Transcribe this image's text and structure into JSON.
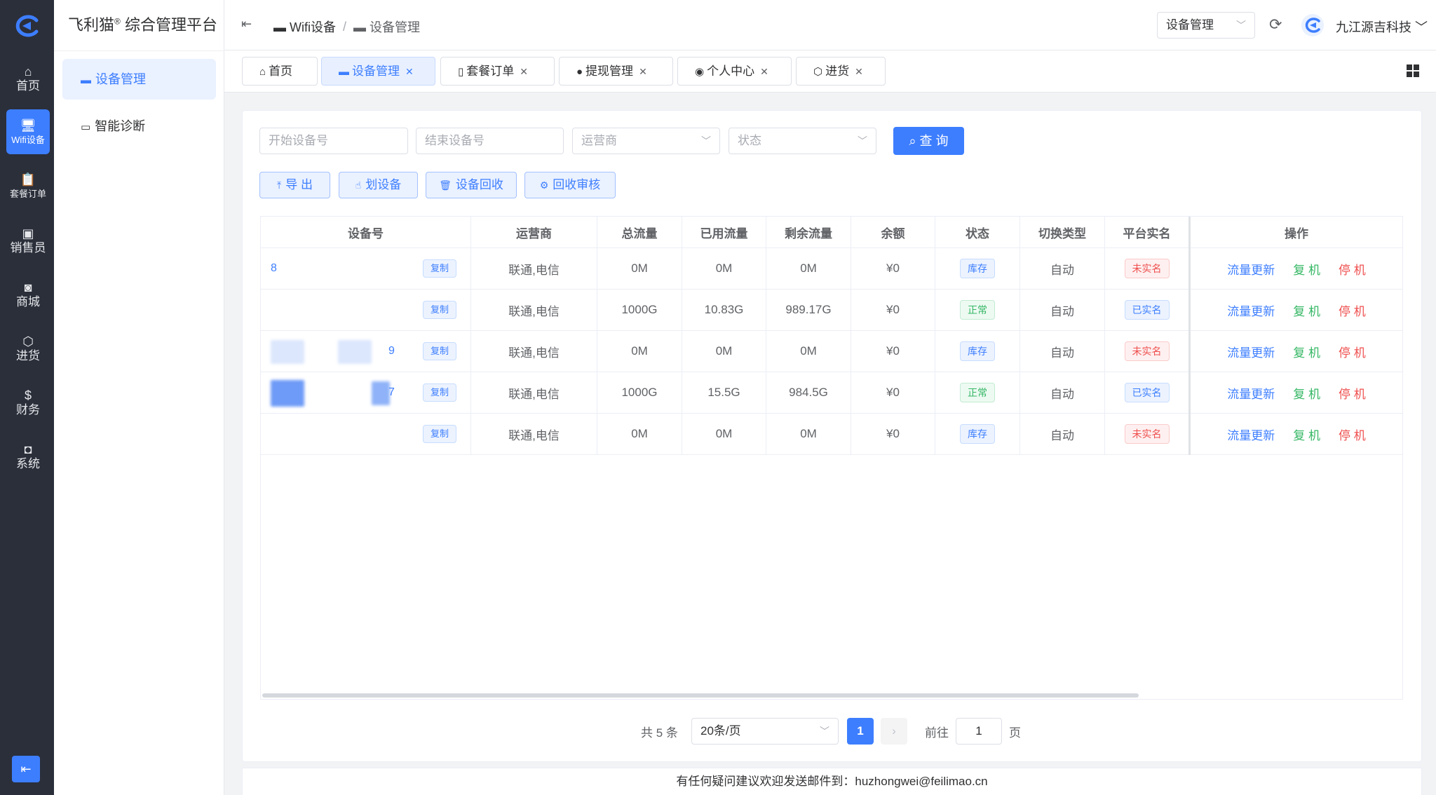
{
  "app": {
    "title_main": "飞利猫",
    "title_sup": "®",
    "title_rest": " 综合管理平台"
  },
  "rail": {
    "items": [
      {
        "label": "首页",
        "icon": "home-icon"
      },
      {
        "label": "Wifi设备",
        "icon": "monitor-icon"
      },
      {
        "label": "套餐订单",
        "icon": "clipboard-icon"
      },
      {
        "label": "销售员",
        "icon": "id-card-icon"
      },
      {
        "label": "商城",
        "icon": "shop-icon"
      },
      {
        "label": "进货",
        "icon": "box-icon"
      },
      {
        "label": "财务",
        "icon": "coin-icon"
      },
      {
        "label": "系统",
        "icon": "user-box-icon"
      }
    ],
    "active_index": 1
  },
  "sidebar": {
    "items": [
      {
        "label": "设备管理"
      },
      {
        "label": "智能诊断"
      }
    ]
  },
  "header": {
    "breadcrumb": [
      "Wifi设备",
      "设备管理"
    ],
    "select_value": "设备管理",
    "user_name": "九江源吉科技"
  },
  "tabs": [
    {
      "label": "首页",
      "closable": false
    },
    {
      "label": "设备管理",
      "closable": true,
      "active": true
    },
    {
      "label": "套餐订单",
      "closable": true
    },
    {
      "label": "提现管理",
      "closable": true
    },
    {
      "label": "个人中心",
      "closable": true
    },
    {
      "label": "进货",
      "closable": true
    }
  ],
  "filters": {
    "start_placeholder": "开始设备号",
    "end_placeholder": "结束设备号",
    "operator_placeholder": "运营商",
    "status_placeholder": "状态",
    "query_label": "查 询"
  },
  "toolbar": {
    "export_label": "导 出",
    "assign_label": "划设备",
    "recycle_label": "设备回收",
    "review_label": "回收审核"
  },
  "table": {
    "headers": [
      "设备号",
      "运营商",
      "总流量",
      "已用流量",
      "剩余流量",
      "余额",
      "状态",
      "切换类型",
      "平台实名",
      "操作"
    ],
    "copy_label": "复制",
    "actions": [
      "流量更新",
      "复 机",
      "停 机"
    ],
    "rows": [
      {
        "device_frag_a": "8",
        "device_frag_b": "",
        "operator": "联通,电信",
        "total": "0M",
        "used": "0M",
        "remain": "0M",
        "balance": "¥0",
        "status": "库存",
        "switch": "自动",
        "realname": "未实名"
      },
      {
        "device_frag_a": "",
        "device_frag_b": "",
        "operator": "联通,电信",
        "total": "1000G",
        "used": "10.83G",
        "remain": "989.17G",
        "balance": "¥0",
        "status": "正常",
        "switch": "自动",
        "realname": "已实名"
      },
      {
        "device_frag_a": "",
        "device_frag_b": "9",
        "operator": "联通,电信",
        "total": "0M",
        "used": "0M",
        "remain": "0M",
        "balance": "¥0",
        "status": "库存",
        "switch": "自动",
        "realname": "未实名"
      },
      {
        "device_frag_a": "",
        "device_frag_b": "7",
        "operator": "联通,电信",
        "total": "1000G",
        "used": "15.5G",
        "remain": "984.5G",
        "balance": "¥0",
        "status": "正常",
        "switch": "自动",
        "realname": "已实名"
      },
      {
        "device_frag_a": "",
        "device_frag_b": "",
        "operator": "联通,电信",
        "total": "0M",
        "used": "0M",
        "remain": "0M",
        "balance": "¥0",
        "status": "库存",
        "switch": "自动",
        "realname": "未实名"
      }
    ]
  },
  "pagination": {
    "total_text": "共 5 条",
    "page_size": "20条/页",
    "current_page": "1",
    "goto_label": "前往",
    "goto_value": "1",
    "page_suffix": "页"
  },
  "footer": {
    "text": "有任何疑问建议欢迎发送邮件到：huzhongwei@feilimao.cn"
  },
  "colors": {
    "primary": "#3d7eff",
    "success": "#35b764",
    "danger": "#ef4f4f",
    "rail_bg": "#2b2f3a"
  }
}
